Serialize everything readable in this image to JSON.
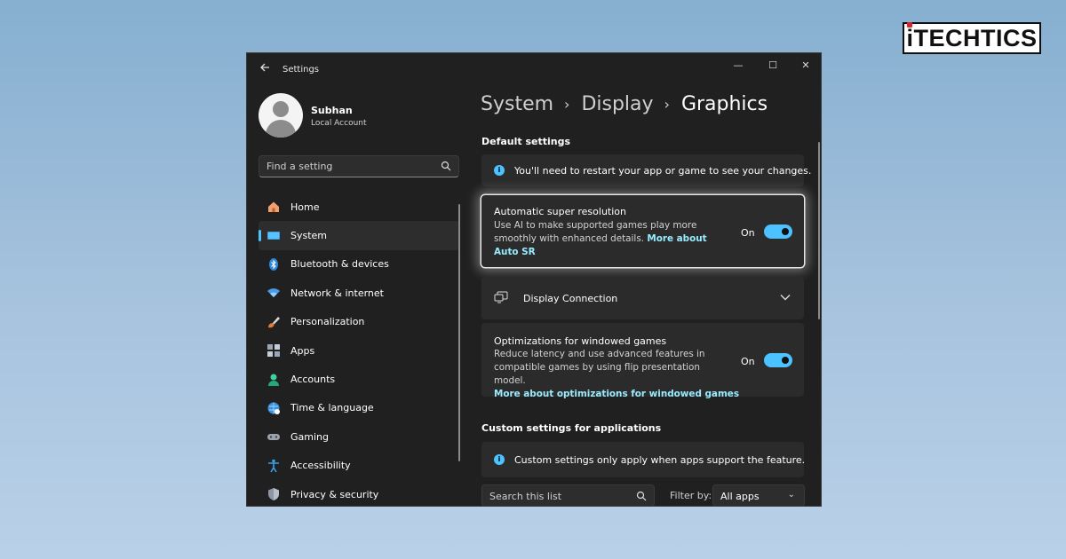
{
  "brand": {
    "logo_text": "iTECHTICS"
  },
  "window": {
    "title": "Settings",
    "controls": {
      "minimize": "—",
      "maximize": "☐",
      "close": "✕"
    }
  },
  "profile": {
    "name": "Subhan",
    "account_type": "Local Account"
  },
  "search": {
    "placeholder": "Find a setting",
    "icon": "search-icon"
  },
  "nav": {
    "items": [
      {
        "label": "Home",
        "icon": "home-icon"
      },
      {
        "label": "System",
        "icon": "system-icon",
        "active": true
      },
      {
        "label": "Bluetooth & devices",
        "icon": "bluetooth-icon"
      },
      {
        "label": "Network & internet",
        "icon": "wifi-icon"
      },
      {
        "label": "Personalization",
        "icon": "brush-icon"
      },
      {
        "label": "Apps",
        "icon": "apps-icon"
      },
      {
        "label": "Accounts",
        "icon": "accounts-icon"
      },
      {
        "label": "Time & language",
        "icon": "globe-icon"
      },
      {
        "label": "Gaming",
        "icon": "gamepad-icon"
      },
      {
        "label": "Accessibility",
        "icon": "accessibility-icon"
      },
      {
        "label": "Privacy & security",
        "icon": "shield-icon"
      }
    ]
  },
  "breadcrumb": {
    "items": [
      "System",
      "Display",
      "Graphics"
    ],
    "separator": "›"
  },
  "default_settings": {
    "heading": "Default settings",
    "info": "You'll need to restart your app or game to see your changes.",
    "auto_sr": {
      "title": "Automatic super resolution",
      "description": "Use AI to make supported games play more smoothly with enhanced details.",
      "link": "More about Auto SR",
      "state_label": "On",
      "enabled": true
    },
    "display_connection": {
      "label": "Display Connection"
    },
    "windowed_games": {
      "title": "Optimizations for windowed games",
      "description": "Reduce latency and use advanced features in compatible games by using flip presentation model.",
      "link": "More about optimizations for windowed games",
      "state_label": "On",
      "enabled": true
    }
  },
  "custom_settings": {
    "heading": "Custom settings for applications",
    "info": "Custom settings only apply when apps support the feature.",
    "search_placeholder": "Search this list",
    "filter_label": "Filter by:",
    "filter_value": "All apps"
  },
  "colors": {
    "accent": "#4cc2ff",
    "link": "#99ebff",
    "window_bg": "#202020",
    "card_bg": "#2b2b2b"
  }
}
